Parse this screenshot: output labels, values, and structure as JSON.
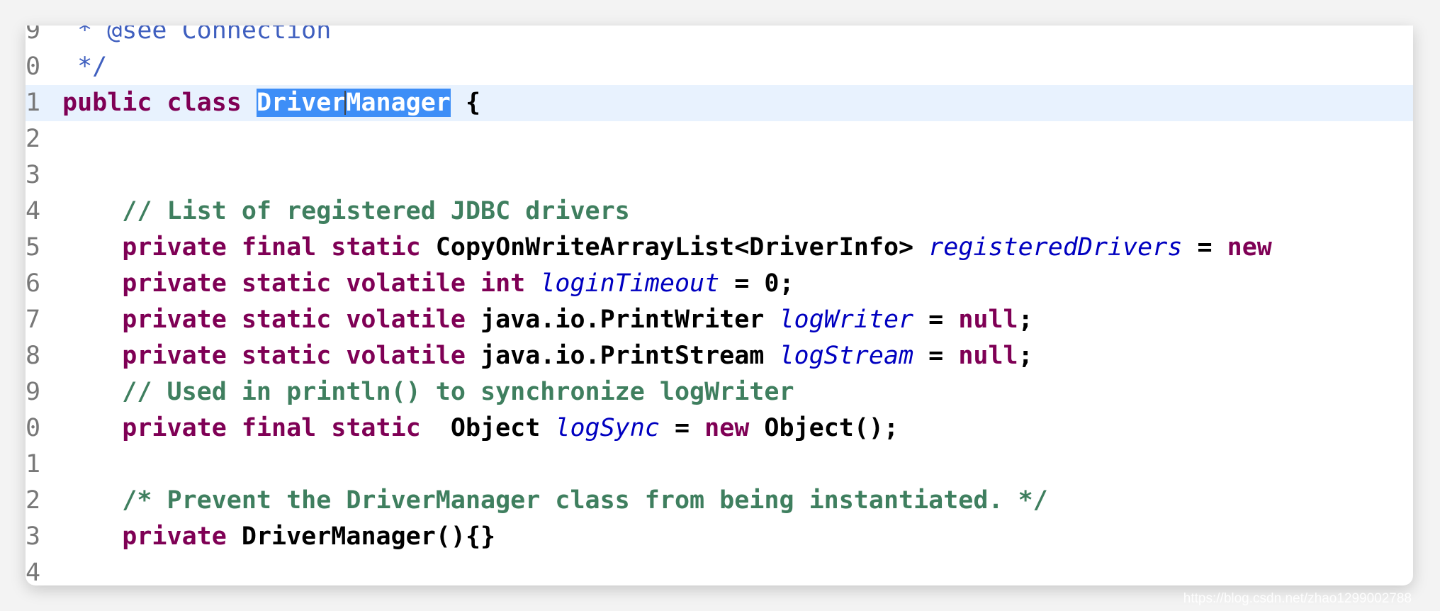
{
  "editor": {
    "current_line_index": 2,
    "colors": {
      "keyword": "#7f0055",
      "comment": "#3f7f5f",
      "javadoc": "#3f5fbf",
      "field": "#0000c0",
      "selection": "#3e8ef7",
      "current_line": "#e8f2fe"
    },
    "lines": [
      {
        "num": "9",
        "tokens": [
          {
            "t": " * @see ",
            "c": "jd"
          },
          {
            "t": "Connection",
            "c": "jd"
          }
        ]
      },
      {
        "num": "0",
        "tokens": [
          {
            "t": " */",
            "c": "jd"
          }
        ]
      },
      {
        "num": "1",
        "tokens": [
          {
            "t": "public class ",
            "c": "kw"
          },
          {
            "t": "DriverManager",
            "c": "sel"
          },
          {
            "t": " {",
            "c": "tx"
          }
        ]
      },
      {
        "num": "2",
        "tokens": []
      },
      {
        "num": "3",
        "tokens": []
      },
      {
        "num": "4",
        "tokens": [
          {
            "t": "    // List of registered JDBC drivers",
            "c": "cm"
          }
        ]
      },
      {
        "num": "5",
        "tokens": [
          {
            "t": "    private final static ",
            "c": "kw"
          },
          {
            "t": "CopyOnWriteArrayList<DriverInfo> ",
            "c": "tx"
          },
          {
            "t": "registeredDrivers",
            "c": "fd"
          },
          {
            "t": " = ",
            "c": "tx"
          },
          {
            "t": "new",
            "c": "kw"
          }
        ]
      },
      {
        "num": "6",
        "tokens": [
          {
            "t": "    private static volatile int ",
            "c": "kw"
          },
          {
            "t": "loginTimeout",
            "c": "fd"
          },
          {
            "t": " = 0;",
            "c": "tx"
          }
        ]
      },
      {
        "num": "7",
        "tokens": [
          {
            "t": "    private static volatile ",
            "c": "kw"
          },
          {
            "t": "java.io.PrintWriter ",
            "c": "tx"
          },
          {
            "t": "logWriter",
            "c": "fd"
          },
          {
            "t": " = ",
            "c": "tx"
          },
          {
            "t": "null",
            "c": "kw"
          },
          {
            "t": ";",
            "c": "tx"
          }
        ]
      },
      {
        "num": "8",
        "tokens": [
          {
            "t": "    private static volatile ",
            "c": "kw"
          },
          {
            "t": "java.io.PrintStream ",
            "c": "tx"
          },
          {
            "t": "logStream",
            "c": "fd"
          },
          {
            "t": " = ",
            "c": "tx"
          },
          {
            "t": "null",
            "c": "kw"
          },
          {
            "t": ";",
            "c": "tx"
          }
        ]
      },
      {
        "num": "9",
        "tokens": [
          {
            "t": "    // Used in println() to synchronize logWriter",
            "c": "cm"
          }
        ]
      },
      {
        "num": "0",
        "tokens": [
          {
            "t": "    private final static  ",
            "c": "kw"
          },
          {
            "t": "Object ",
            "c": "tx"
          },
          {
            "t": "logSync",
            "c": "fd"
          },
          {
            "t": " = ",
            "c": "tx"
          },
          {
            "t": "new ",
            "c": "kw"
          },
          {
            "t": "Object();",
            "c": "tx"
          }
        ]
      },
      {
        "num": "1",
        "tokens": []
      },
      {
        "num": "2",
        "tokens": [
          {
            "t": "    /* Prevent the DriverManager class from being instantiated. */",
            "c": "cm"
          }
        ]
      },
      {
        "num": "3",
        "tokens": [
          {
            "t": "    private ",
            "c": "kw"
          },
          {
            "t": "DriverManager(){}",
            "c": "tx"
          }
        ]
      },
      {
        "num": "4",
        "tokens": []
      }
    ]
  },
  "watermark": "https://blog.csdn.net/zhao1299002788"
}
